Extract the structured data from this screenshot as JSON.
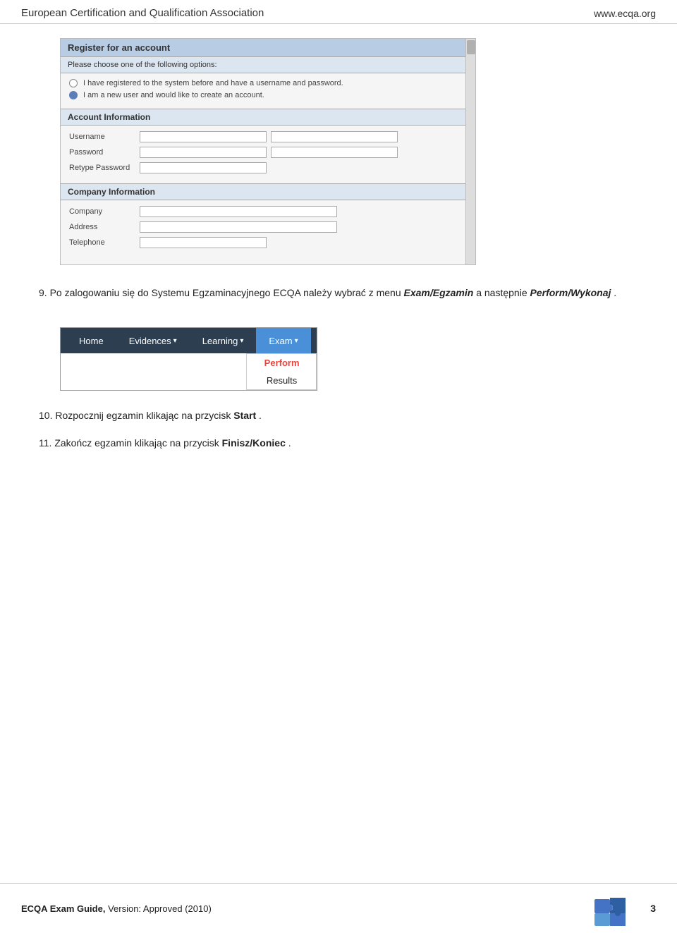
{
  "header": {
    "title": "European Certification and Qualification Association",
    "url": "www.ecqa.org"
  },
  "screenshot": {
    "form_title": "Register for an account",
    "instruction": "Please choose one of the following options:",
    "options": [
      {
        "text": "I have registered to the system before and have a username and password.",
        "selected": false
      },
      {
        "text": "I am a new user and would like to create an account.",
        "selected": true
      }
    ],
    "account_section": "Account Information",
    "account_fields": [
      {
        "label": "Username"
      },
      {
        "label": "Password"
      },
      {
        "label": "Retype Password"
      }
    ],
    "company_section": "Company Information",
    "company_fields": [
      {
        "label": "Company"
      },
      {
        "label": "Address"
      },
      {
        "label": "Telephone"
      }
    ]
  },
  "paragraph9": {
    "number": "9.",
    "text": "Po zalogowaniu się do Systemu Egzaminacyjnego ECQA należy wybrać z menu ",
    "bold1": "Exam/Egzamin",
    "mid": " a następnie ",
    "bold2": "Perform/Wykonaj",
    "end": "."
  },
  "navbar": {
    "items": [
      {
        "label": "Home",
        "active": false
      },
      {
        "label": "Evidences",
        "active": false,
        "has_arrow": true
      },
      {
        "label": "Learning",
        "active": false,
        "has_arrow": true
      },
      {
        "label": "Exam",
        "active": true,
        "has_arrow": true
      }
    ],
    "dropdown": {
      "items": [
        {
          "label": "Perform",
          "highlighted": true
        },
        {
          "label": "Results",
          "highlighted": false
        }
      ]
    }
  },
  "paragraph10": {
    "number": "10.",
    "text": "Rozpocznij egzamin klikając na przycisk ",
    "bold": "Start",
    "end": "."
  },
  "paragraph11": {
    "number": "11.",
    "text": "Zakończ egzamin klikając na przycisk ",
    "bold": "Finisz/Koniec",
    "end": "."
  },
  "footer": {
    "left_bold": "ECQA Exam Guide,",
    "left_normal": " Version: Approved (2010)",
    "page_number": "3"
  }
}
